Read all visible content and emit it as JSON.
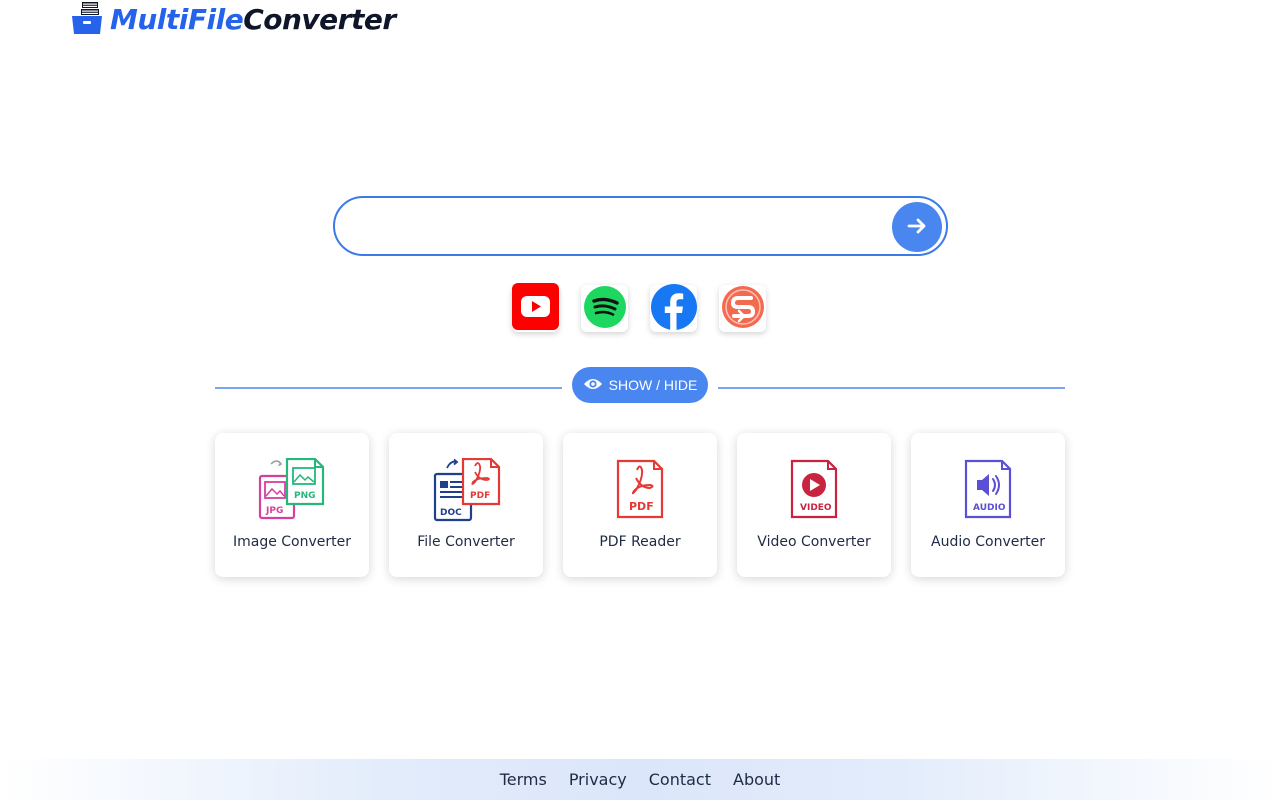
{
  "header": {
    "logo_part_a": "MultiFile",
    "logo_part_b": "Converter",
    "logo_icon": "file-box-icon"
  },
  "search": {
    "value": "",
    "placeholder": "",
    "submit_icon": "arrow-right-icon"
  },
  "socials": [
    {
      "name": "youtube",
      "icon": "youtube-icon",
      "color": "#ff0000"
    },
    {
      "name": "spotify",
      "icon": "spotify-icon",
      "color": "#1ed760"
    },
    {
      "name": "facebook",
      "icon": "facebook-icon",
      "color": "#1877f2"
    },
    {
      "name": "savefrom",
      "icon": "savefrom-icon",
      "color": "#f46a4e"
    }
  ],
  "toggle": {
    "label": "SHOW / HIDE",
    "icon": "eye-icon"
  },
  "tools": [
    {
      "label": "Image Converter",
      "icon": "image-converter-icon",
      "badge_a": "JPG",
      "badge_b": "PNG"
    },
    {
      "label": "File Converter",
      "icon": "file-converter-icon",
      "badge_a": "DOC",
      "badge_b": "PDF"
    },
    {
      "label": "PDF Reader",
      "icon": "pdf-reader-icon",
      "badge": "PDF"
    },
    {
      "label": "Video Converter",
      "icon": "video-converter-icon",
      "badge": "VIDEO"
    },
    {
      "label": "Audio Converter",
      "icon": "audio-converter-icon",
      "badge": "AUDIO"
    }
  ],
  "footer": {
    "links": [
      "Terms",
      "Privacy",
      "Contact",
      "About"
    ]
  },
  "colors": {
    "accent": "#4a86f0",
    "brand_blue": "#2563eb",
    "text_dark": "#1f2a44"
  }
}
